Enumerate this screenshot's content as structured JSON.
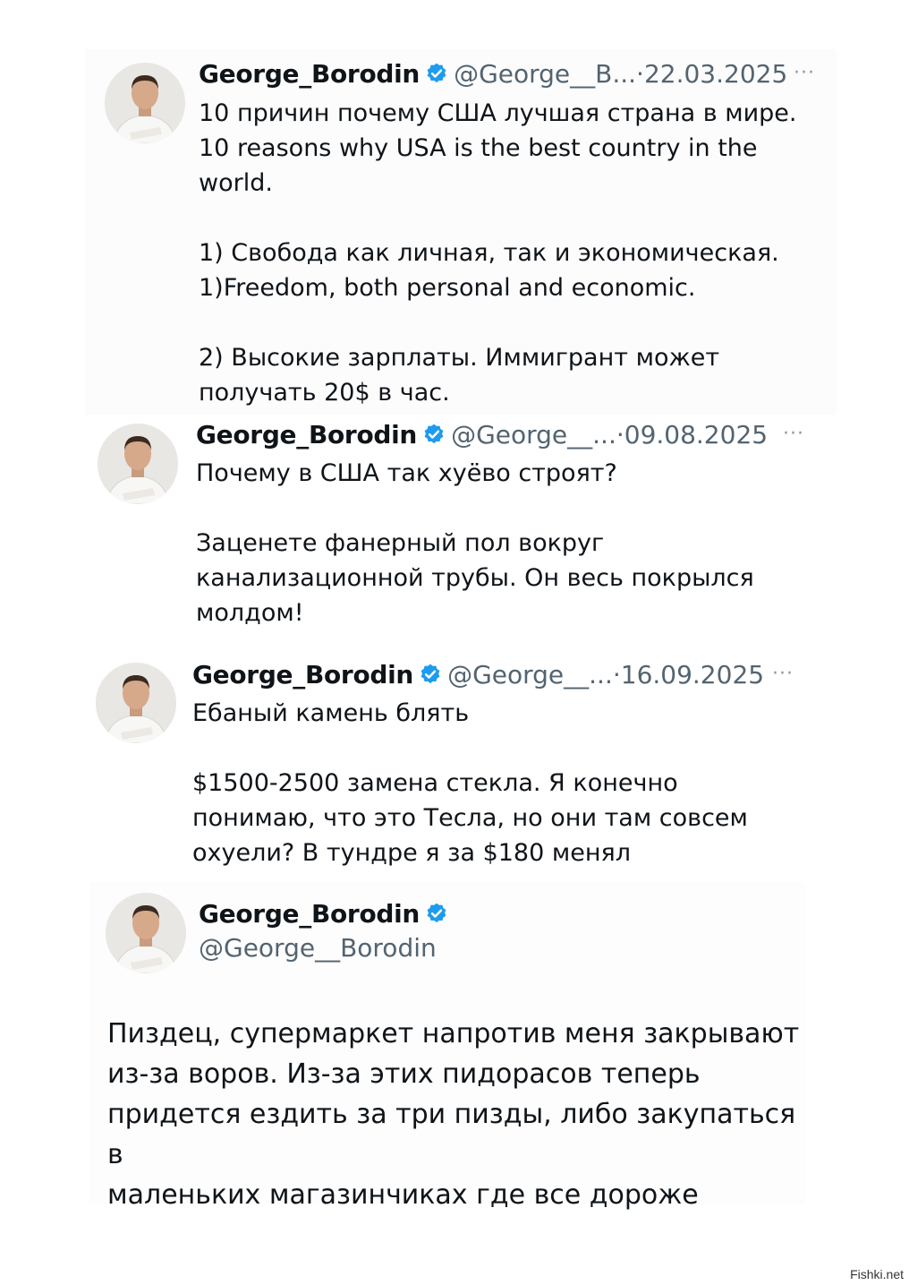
{
  "accent_color": "#1d9bf0",
  "tweets": [
    {
      "name": "George_Borodin",
      "handle": "@George__B...",
      "date": "22.03.2025",
      "lines": [
        "10 причин почему США лучшая страна в мире.",
        "10 reasons why USA is the best country in the",
        "world.",
        "",
        "1) Свобода как личная, так и экономическая.",
        "1)Freedom, both personal and economic.",
        "",
        "2) Высокие зарплаты. Иммигрант может",
        "получать 20$ в час."
      ]
    },
    {
      "name": "George_Borodin",
      "handle": "@George__...",
      "date": "09.08.2025",
      "lines": [
        "Почему в США так хуёво строят?",
        "",
        "Заценете фанерный пол вокруг",
        "канализационной трубы. Он весь покрылся",
        "молдом!"
      ]
    },
    {
      "name": "George_Borodin",
      "handle": "@George__...",
      "date": "16.09.2025",
      "lines": [
        "Ебаный камень блять",
        "",
        "$1500-2500 замена стекла. Я конечно",
        "понимаю, что это Тесла, но они там совсем",
        "охуели? В тундре я за $180 менял"
      ]
    },
    {
      "name": "George_Borodin",
      "handle": "@George__Borodin",
      "lines": [
        "Пиздец, супермаркет напротив меня закрывают",
        "из-за воров. Из-за этих пидорасов теперь",
        "придется ездить за три пизды, либо закупаться в",
        "маленьких магазинчиках где все дороже"
      ]
    }
  ],
  "separator": "·",
  "more_glyph": "···",
  "watermark": "Fishki.net"
}
